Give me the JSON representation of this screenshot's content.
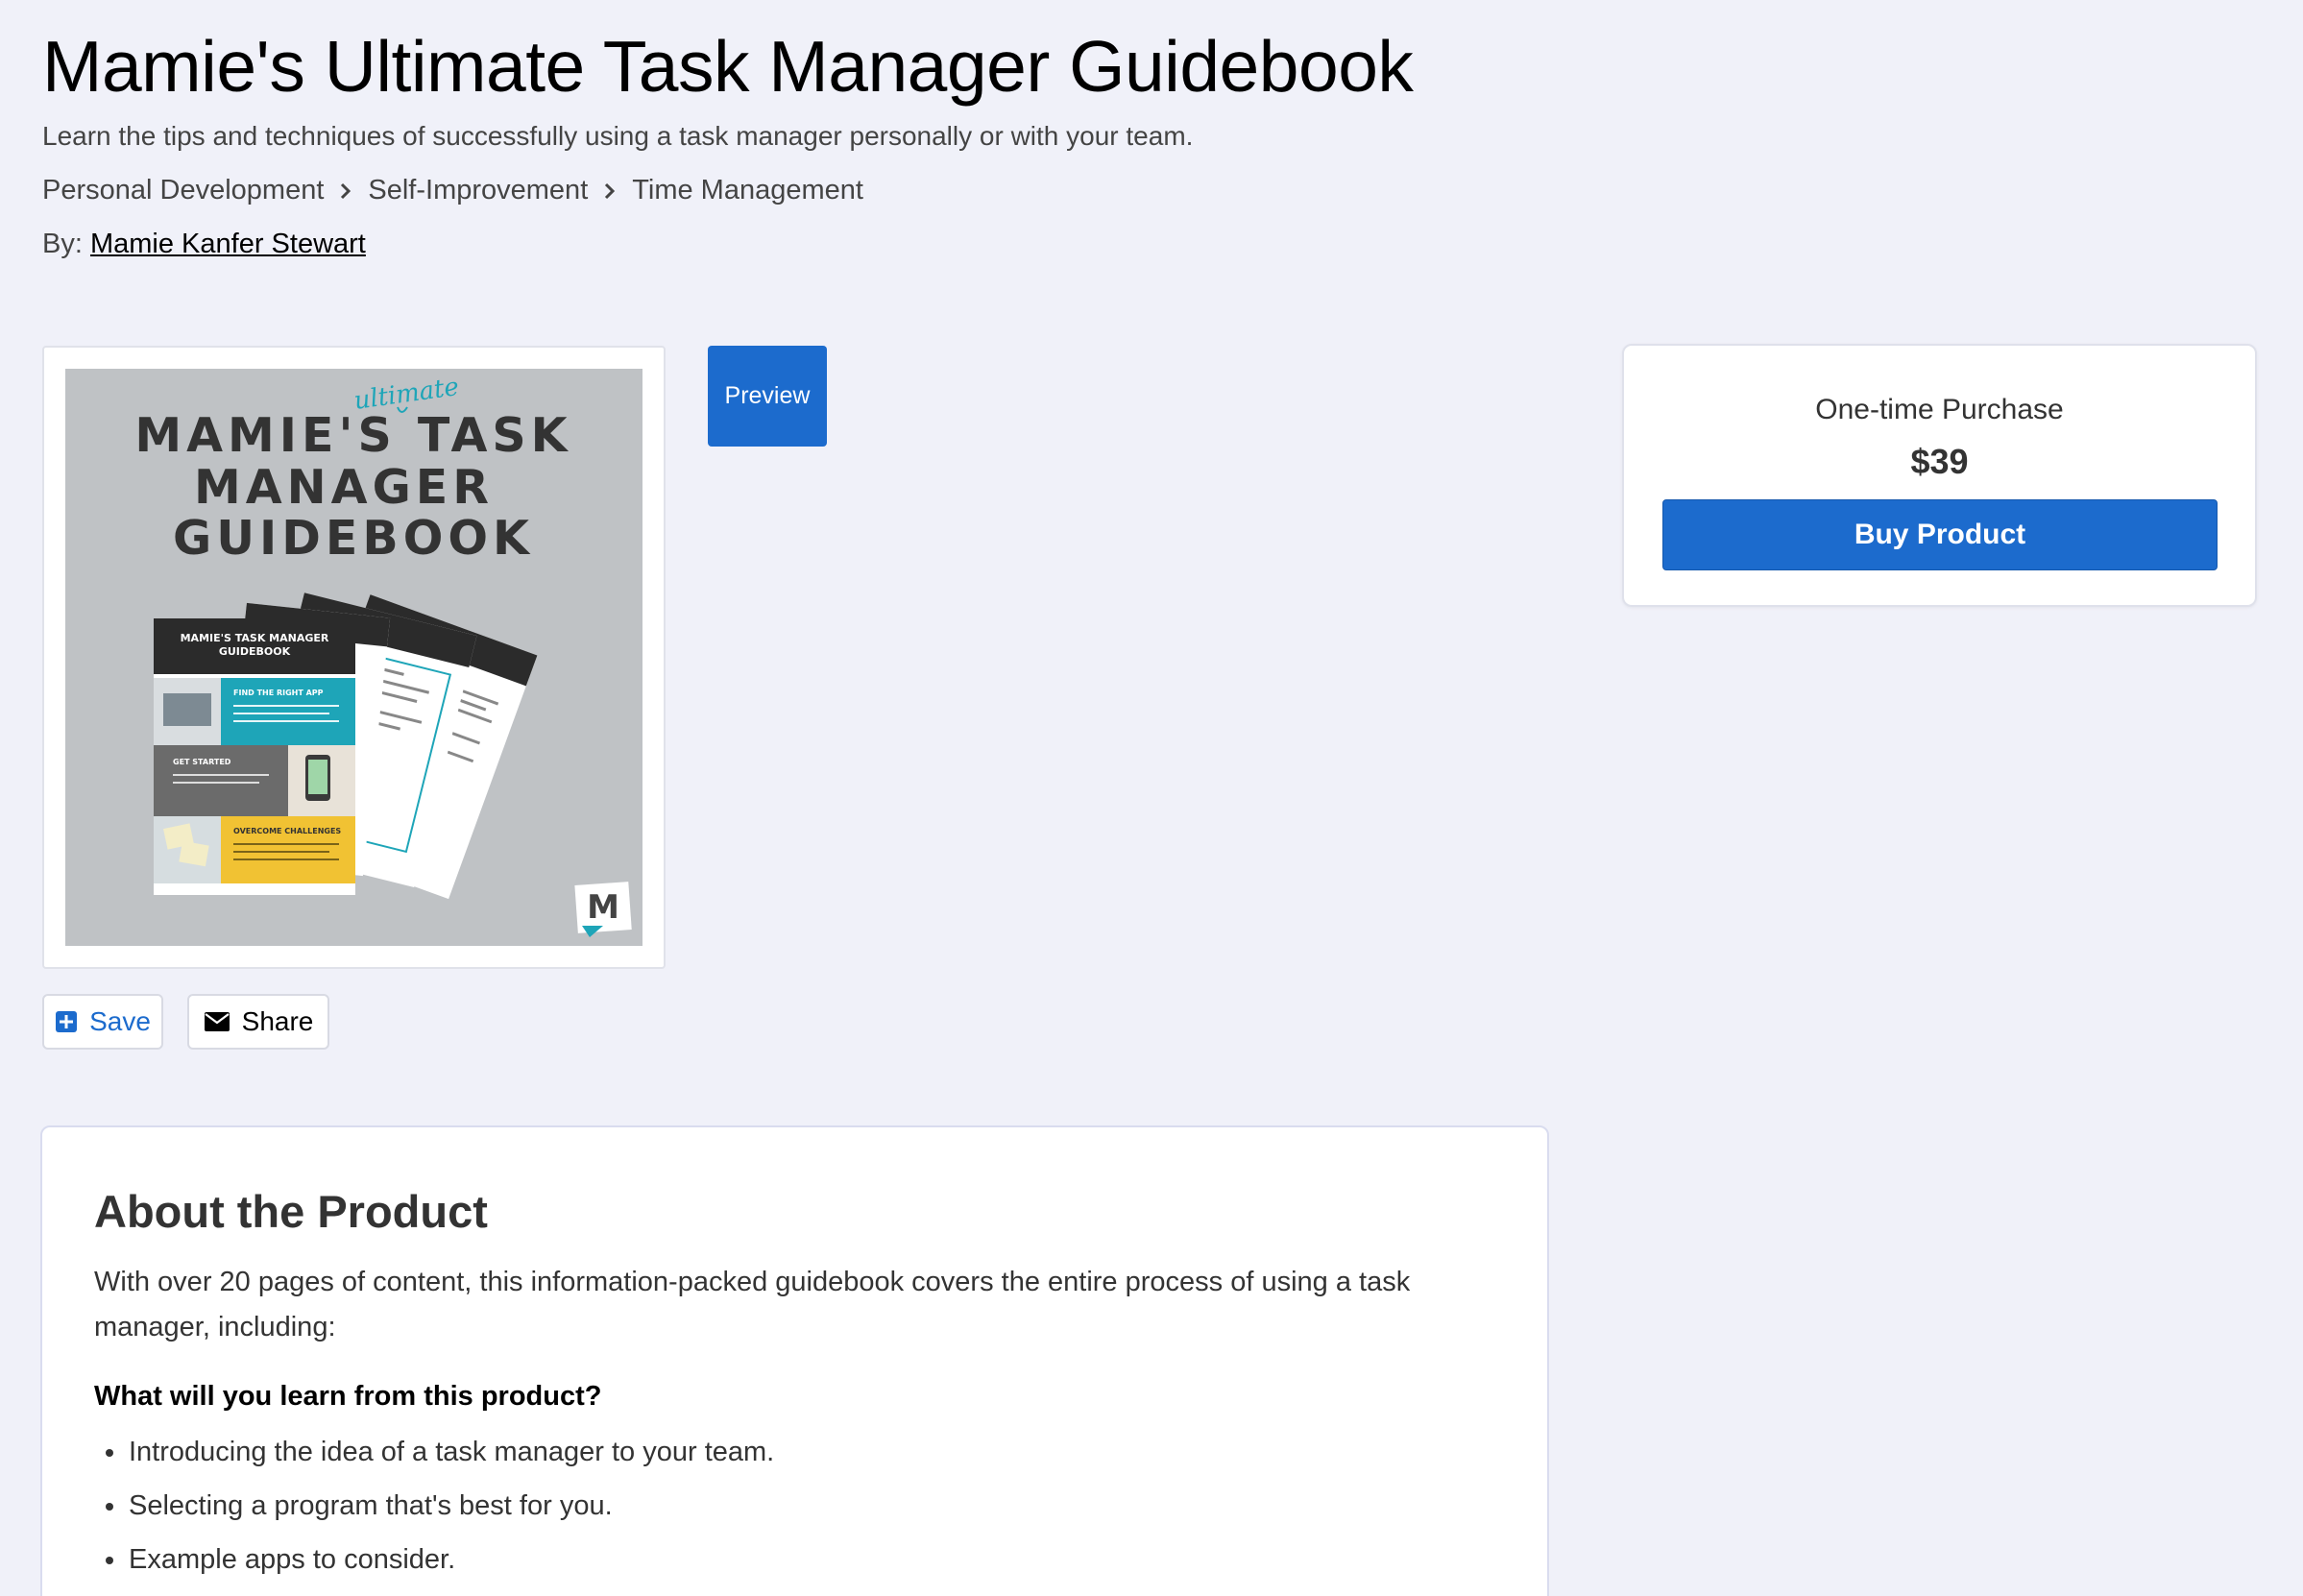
{
  "product": {
    "title": "Mamie's Ultimate Task Manager Guidebook",
    "subtitle": "Learn the tips and techniques of successfully using a task manager personally or with your team.",
    "breadcrumb": [
      "Personal Development",
      "Self-Improvement",
      "Time Management"
    ],
    "author_prefix": "By:",
    "author_name": "Mamie Kanfer Stewart"
  },
  "cover": {
    "title_lines": [
      "MAMIE'S TASK",
      "MANAGER",
      "GUIDEBOOK"
    ],
    "script_word": "ultimate",
    "front_page_title": [
      "MAMIE'S TASK MANAGER",
      "GUIDEBOOK"
    ],
    "sections": [
      "FIND THE RIGHT APP",
      "GET STARTED",
      "OVERCOME CHALLENGES"
    ],
    "logo_letter": "M",
    "colors": {
      "background": "#bfc2c5",
      "title": "#333333",
      "teal": "#1ea5b8",
      "dark": "#2b2b2b",
      "gray": "#6b6b6b",
      "yellow": "#f1c233"
    }
  },
  "actions": {
    "preview_label": "Preview",
    "save_label": "Save",
    "share_label": "Share"
  },
  "purchase": {
    "type": "One-time Purchase",
    "price": "$39",
    "buy_label": "Buy Product"
  },
  "about": {
    "title": "About the Product",
    "description": "With over 20 pages of content, this information-packed guidebook covers the entire process of using a task manager, including:",
    "learn_heading": "What will you learn from this product?",
    "learn_items": [
      "Introducing the idea of a task manager to your team.",
      "Selecting a program that's best for you.",
      "Example apps to consider."
    ]
  },
  "theme": {
    "accent": "#1c6bcd",
    "page_background": "#f0f1f9"
  }
}
